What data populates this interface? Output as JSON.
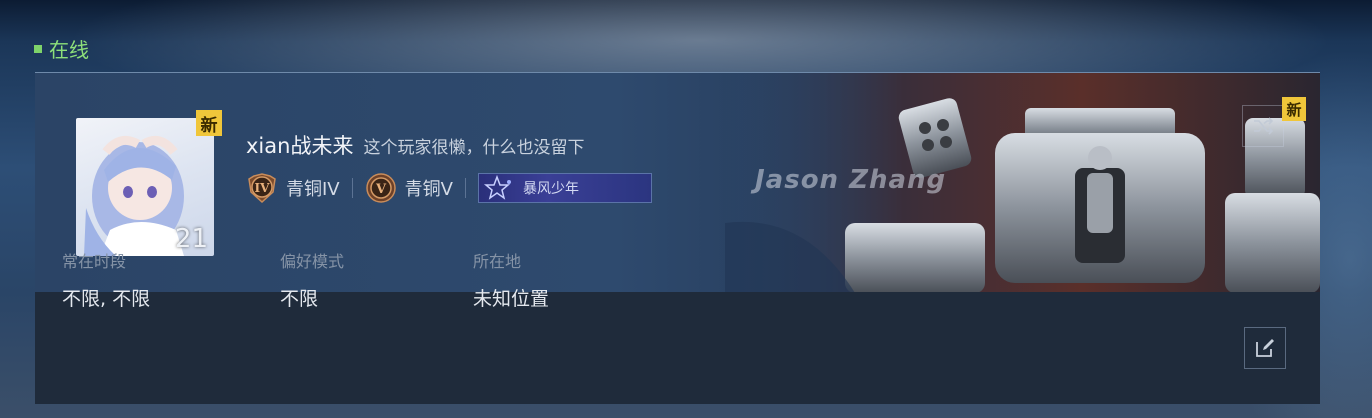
{
  "status": {
    "label": "在线",
    "color": "#7ed36a"
  },
  "profile": {
    "avatar_level": "21",
    "avatar_badge": "新",
    "name": "xian战未来",
    "bio": "这个玩家很懒，什么也没留下"
  },
  "ranks": [
    {
      "icon": "rank-bronze-IV-icon",
      "glyph": "IV",
      "label": "青铜IV"
    },
    {
      "icon": "rank-bronze-V-icon",
      "glyph": "V",
      "label": "青铜V"
    }
  ],
  "title_badge": {
    "icon": "star-icon",
    "label": "暴风少年"
  },
  "banner": {
    "badge": "新",
    "signature": "Jason Zhang",
    "action_icon": "shuffle-icon"
  },
  "info": {
    "active_time": {
      "label": "常在时段",
      "value": "不限, 不限"
    },
    "preferred_mode": {
      "label": "偏好模式",
      "value": "不限"
    },
    "location": {
      "label": "所在地",
      "value": "未知位置"
    }
  },
  "edit_icon": "edit-icon",
  "colors": {
    "accent_online": "#8de07a",
    "badge_yellow": "#f0c63a",
    "card_bg": "#2b4466",
    "footer_bg": "#1f2b3b"
  }
}
